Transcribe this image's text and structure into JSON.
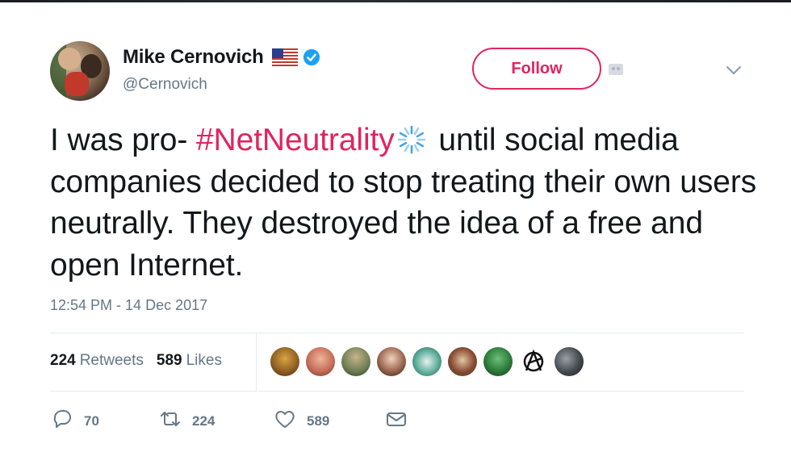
{
  "tweet": {
    "author": {
      "display_name": "Mike Cernovich",
      "handle": "@Cernovich",
      "flag_icon": "us-flag-icon",
      "verified": true
    },
    "follow_label": "Follow",
    "text": {
      "part1": "I was pro- ",
      "hashtag": "#NetNeutrality",
      "part2": " until social media companies decided to stop treating their own users neutrally. They destroyed the idea of a free and open Internet."
    },
    "timestamp": "12:54 PM - 14 Dec 2017",
    "stats": {
      "retweets_count": "224",
      "retweets_label": "Retweets",
      "likes_count": "589",
      "likes_label": "Likes"
    },
    "likers_count_shown": 9,
    "actions": {
      "replies": "70",
      "retweets": "224",
      "likes": "589"
    }
  },
  "colors": {
    "accent_pink": "#e0245e",
    "verified_blue": "#1da1f2",
    "muted_gray": "#657786",
    "text": "#14171a"
  }
}
